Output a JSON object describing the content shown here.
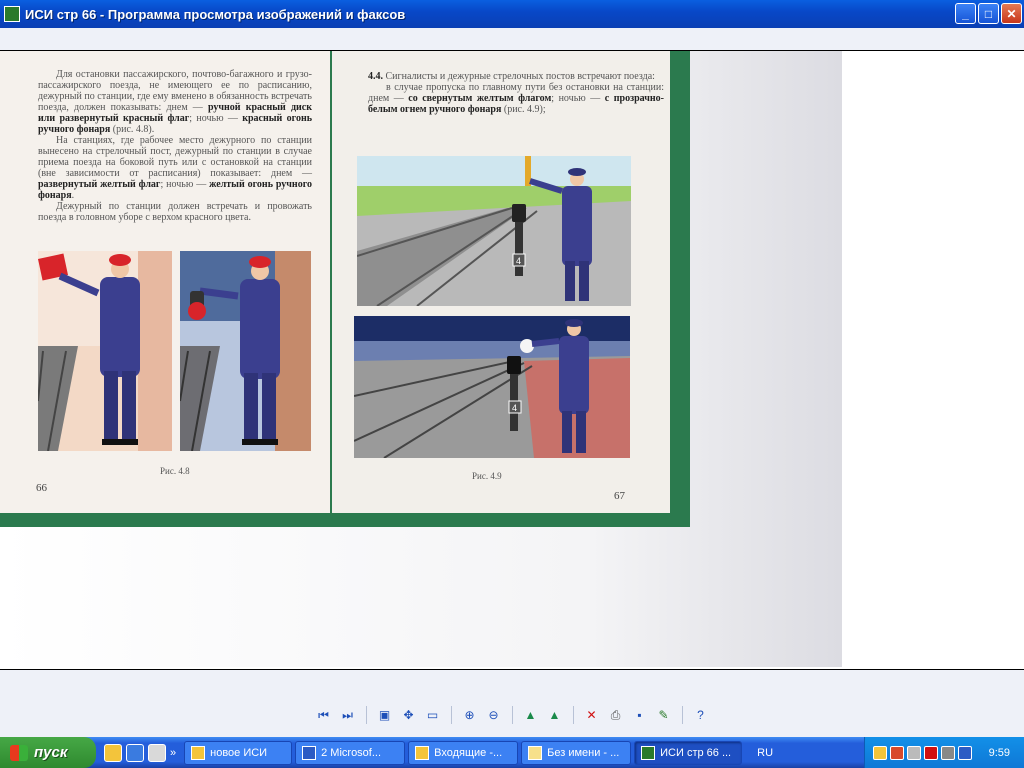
{
  "window": {
    "title": "ИСИ стр 66 - Программа просмотра изображений и факсов",
    "minimize_label": "_",
    "maximize_label": "□",
    "close_label": "✕"
  },
  "document": {
    "left_page": {
      "para1_start": "Для остановки пассажирского, почтово-багажного и грузо-пассажирского поезда, не имеющего ее по расписанию, дежурный по станции, где ему вменено в обязанность встречать поезда, должен показывать: днем — ",
      "para1_bold1": "ручной красный диск или развернутый красный флаг",
      "para1_mid": "; ночью — ",
      "para1_bold2": "красный огонь ручного фонаря",
      "para1_end": " (рис. 4.8).",
      "para2_start": "На станциях, где рабочее место дежурного по станции вынесено на стрелочный пост, дежурный по станции в случае приема поезда на боковой путь или с остановкой на станции (вне зависимости от расписания) показывает: днем — ",
      "para2_bold1": "развернутый желтый флаг",
      "para2_mid": "; ночью — ",
      "para2_bold2": "желтый огонь ручного фонаря",
      "para2_end": ".",
      "para3": "Дежурный по станции должен встречать и провожать поезда в головном уборе с верхом красного цвета.",
      "caption": "Рис. 4.8",
      "page_number": "66"
    },
    "right_page": {
      "heading_num": "4.4.",
      "heading": " Сигналисты и дежурные стрелочных постов встречают поезда:",
      "para1_start": "в случае пропуска по главному пути без остановки на станции: днем — ",
      "para1_bold1": "со свернутым желтым флагом",
      "para1_mid": "; ночью — ",
      "para1_bold2": "с прозрачно-белым огнем ручного фонаря",
      "para1_end": " (рис. 4.9);",
      "switch_number": "4",
      "caption": "Рис. 4.9",
      "page_number": "67"
    }
  },
  "toolbar": {
    "buttons": [
      "previous-image",
      "next-image",
      "best-fit",
      "actual-size",
      "slideshow",
      "zoom-in",
      "zoom-out",
      "rotate-clockwise",
      "rotate-counterclockwise",
      "delete",
      "print",
      "save",
      "edit",
      "help"
    ]
  },
  "taskbar": {
    "start_label": "пуск",
    "tasks": [
      {
        "label": "новое ИСИ"
      },
      {
        "label": "2 Microsof..."
      },
      {
        "label": "Входящие -..."
      },
      {
        "label": "Без имени - ..."
      },
      {
        "label": "ИСИ стр 66 ..."
      }
    ],
    "language": "RU",
    "clock": "9:59"
  }
}
